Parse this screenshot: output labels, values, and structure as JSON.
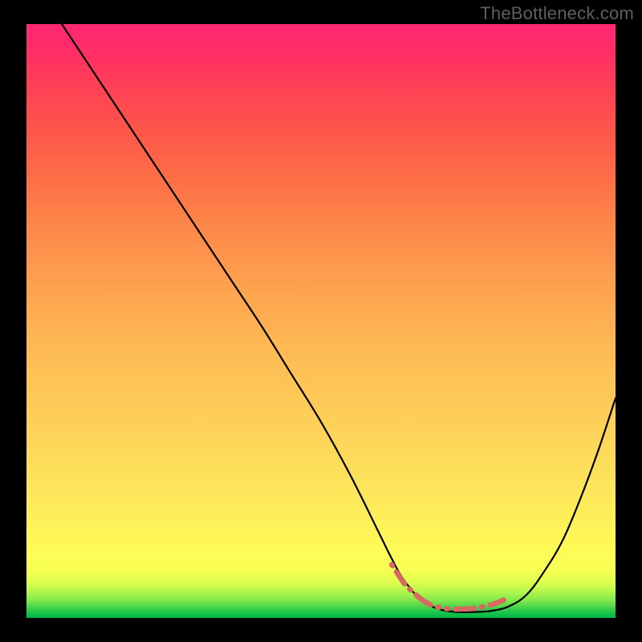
{
  "watermark": "TheBottleneck.com",
  "chart_data": {
    "type": "line",
    "title": "",
    "xlabel": "",
    "ylabel": "",
    "xlim": [
      0,
      100
    ],
    "ylim": [
      0,
      100
    ],
    "grid": false,
    "legend": false,
    "background_gradient": {
      "direction": "vertical",
      "stops": [
        {
          "pos": 0,
          "color": "#00b64a"
        },
        {
          "pos": 6,
          "color": "#dcff50"
        },
        {
          "pos": 11,
          "color": "#fefc56"
        },
        {
          "pos": 28,
          "color": "#fdd95a"
        },
        {
          "pos": 47,
          "color": "#fdb653"
        },
        {
          "pos": 66,
          "color": "#fd8749"
        },
        {
          "pos": 82,
          "color": "#fd564b"
        },
        {
          "pos": 94,
          "color": "#ff3261"
        },
        {
          "pos": 100,
          "color": "#ff2873"
        }
      ]
    },
    "series": [
      {
        "name": "curve",
        "color": "#000000",
        "width": 2,
        "x": [
          6,
          10,
          15,
          20,
          25,
          30,
          35,
          40,
          45,
          50,
          55,
          60,
          62,
          64,
          67,
          70,
          73,
          76,
          79,
          82,
          85,
          88,
          91,
          94,
          97,
          100
        ],
        "y": [
          100,
          94,
          86.5,
          79,
          71.5,
          64,
          56.5,
          49,
          41,
          33,
          24,
          14,
          10,
          6.5,
          3,
          1.5,
          1,
          1,
          1.2,
          2,
          4,
          8,
          13,
          20,
          28,
          37
        ]
      },
      {
        "name": "optimal-band",
        "color": "#d66a63",
        "width": 5,
        "style": "dashed-dotted",
        "x": [
          62,
          64,
          66,
          68,
          70,
          72,
          74,
          76,
          78,
          80,
          82
        ],
        "y": [
          9,
          6,
          4,
          2.5,
          1.8,
          1.5,
          1.5,
          1.6,
          2,
          2.6,
          3.5
        ]
      }
    ]
  }
}
